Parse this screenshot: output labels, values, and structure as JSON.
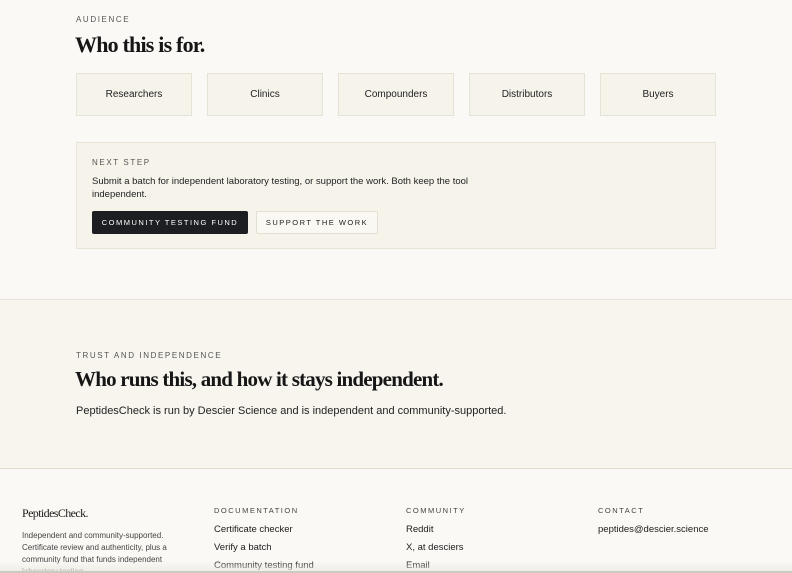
{
  "audience": {
    "eyebrow": "AUDIENCE",
    "title": "Who this is for.",
    "cards": [
      "Researchers",
      "Clinics",
      "Compounders",
      "Distributors",
      "Buyers"
    ]
  },
  "next_step": {
    "eyebrow": "NEXT STEP",
    "text": "Submit a batch for independent laboratory testing, or support the work. Both keep the tool independent.",
    "primary_button": "COMMUNITY TESTING FUND",
    "secondary_button": "SUPPORT THE WORK"
  },
  "trust": {
    "eyebrow": "TRUST AND INDEPENDENCE",
    "title": "Who runs this, and how it stays independent.",
    "text": "PeptidesCheck is run by Descier Science and is independent and community-supported."
  },
  "footer": {
    "brand": "PeptidesCheck.",
    "description": "Independent and community-supported. Certificate review and authenticity, plus a community fund that funds independent laboratory testing.",
    "documentation": {
      "heading": "DOCUMENTATION",
      "links": [
        "Certificate checker",
        "Verify a batch",
        "Community testing fund"
      ]
    },
    "community": {
      "heading": "COMMUNITY",
      "links": [
        "Reddit",
        "X, at desciers",
        "Email"
      ]
    },
    "contact": {
      "heading": "CONTACT",
      "email": "peptides@descier.science"
    }
  }
}
